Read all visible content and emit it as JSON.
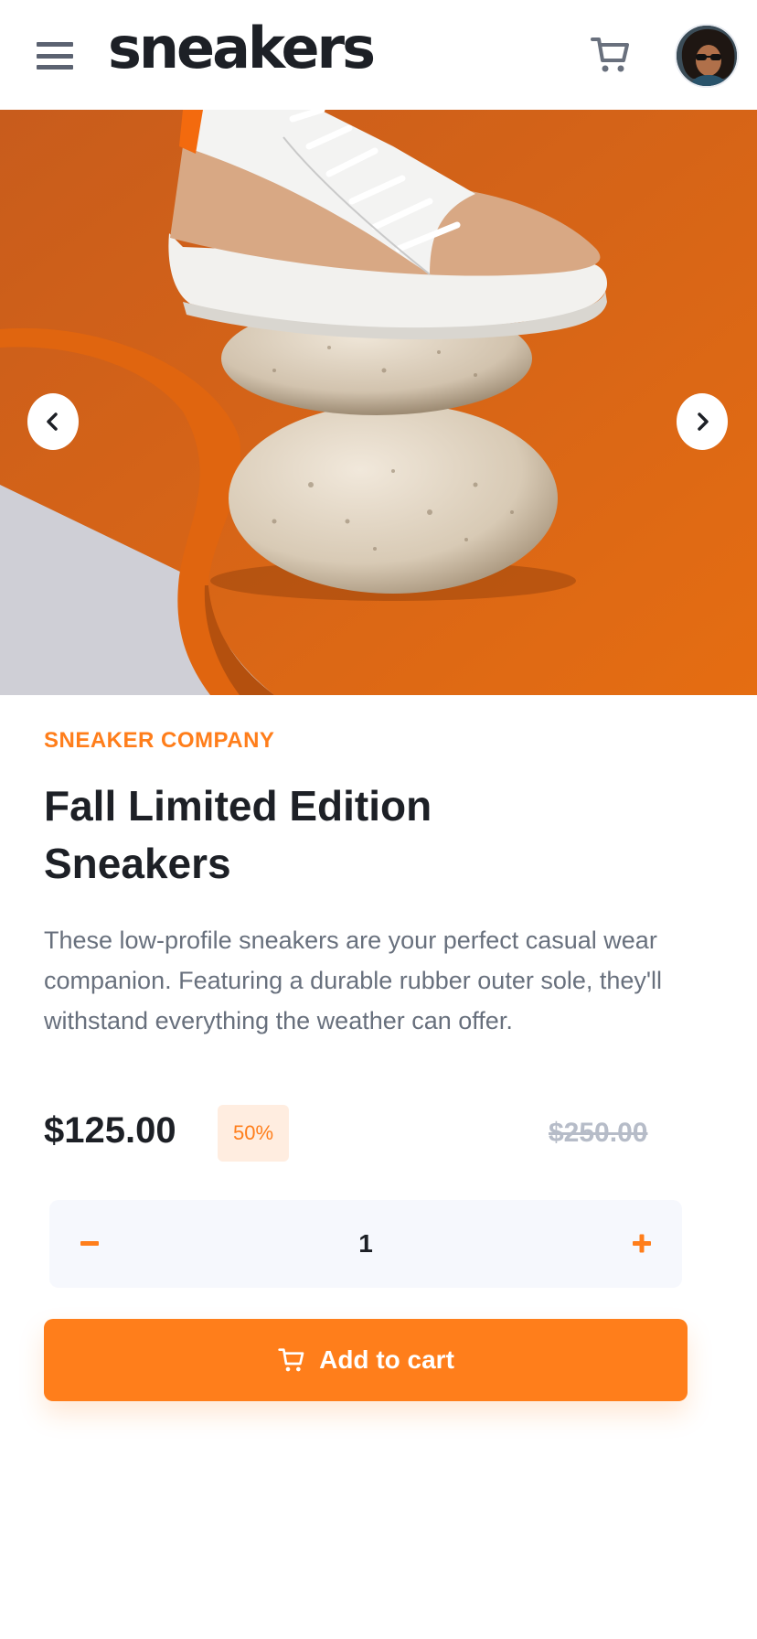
{
  "header": {
    "logo": "sneakers",
    "menu_icon": "hamburger-menu-icon",
    "cart_icon": "cart-icon",
    "avatar": "user-avatar"
  },
  "gallery": {
    "prev_icon": "chevron-left-icon",
    "next_icon": "chevron-right-icon"
  },
  "product": {
    "company": "SNEAKER COMPANY",
    "title": "Fall Limited Edition Sneakers",
    "description": "These low-profile sneakers are your perfect casual wear companion. Featuring a durable rubber outer sole, they'll withstand everything the weather can offer.",
    "price": "$125.00",
    "discount": "50%",
    "original_price": "$250.00"
  },
  "quantity": {
    "value": "1",
    "minus_icon": "minus-icon",
    "plus_icon": "plus-icon"
  },
  "add_to_cart": {
    "label": "Add to cart",
    "icon": "cart-icon"
  },
  "colors": {
    "accent": "#ff7e1b",
    "accent_pale": "#ffede0",
    "dark": "#1d2026",
    "grey_text": "#68707d",
    "grey_strike": "#b6bcc8",
    "qty_bg": "#f6f8fd"
  }
}
